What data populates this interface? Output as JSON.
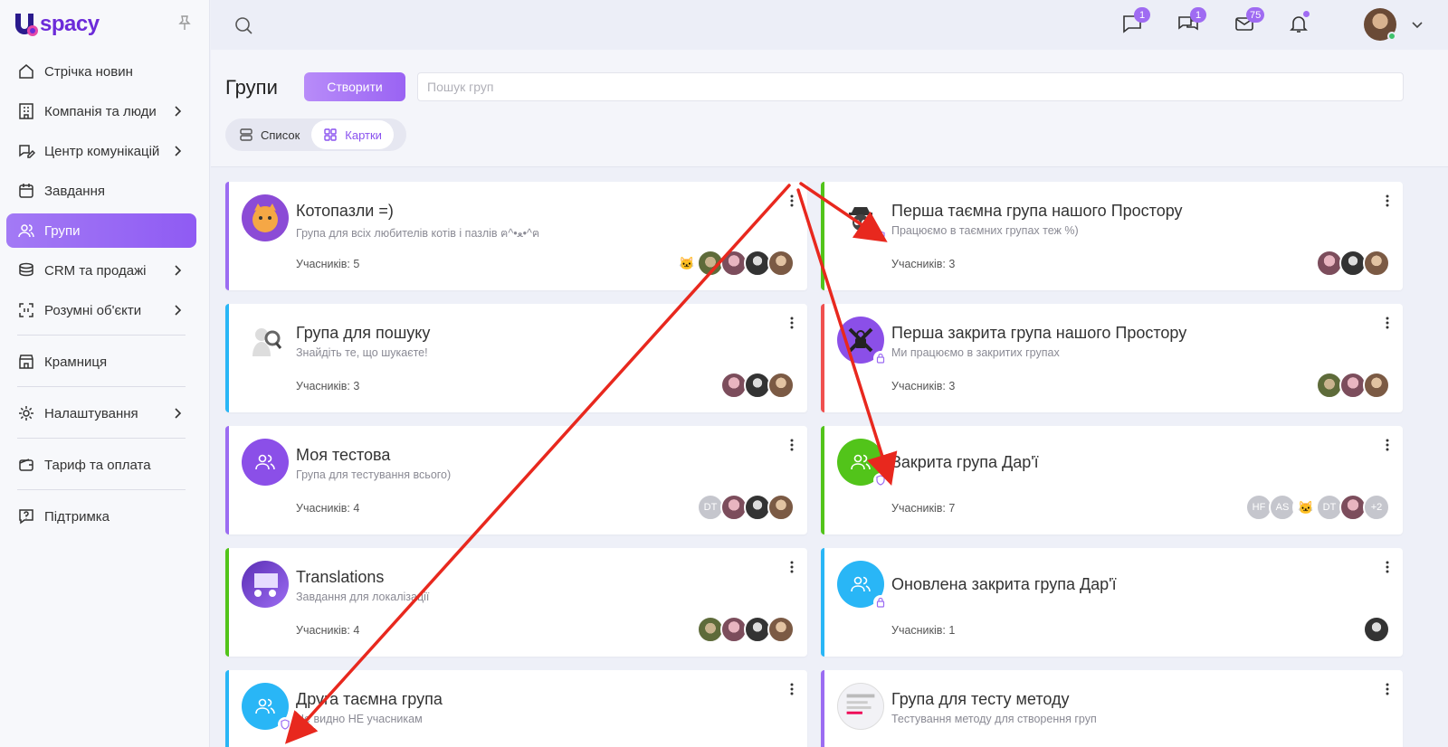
{
  "app": {
    "brand": "spacy",
    "brand_initial": "U"
  },
  "sidebar": {
    "items": [
      {
        "label": "Стрічка новин",
        "icon": "home-icon",
        "chevron": false
      },
      {
        "label": "Компанія та люди",
        "icon": "building-icon",
        "chevron": true
      },
      {
        "label": "Центр комунікацій",
        "icon": "chat-edit-icon",
        "chevron": true
      },
      {
        "label": "Завдання",
        "icon": "calendar-icon",
        "chevron": false
      },
      {
        "label": "Групи",
        "icon": "users-icon",
        "chevron": false,
        "active": true
      },
      {
        "label": "CRM та продажі",
        "icon": "coins-icon",
        "chevron": true
      },
      {
        "label": "Розумні об'єкти",
        "icon": "scan-icon",
        "chevron": true
      },
      {
        "label": "Крамниця",
        "icon": "store-icon",
        "chevron": false
      },
      {
        "label": "Налаштування",
        "icon": "gear-icon",
        "chevron": true
      },
      {
        "label": "Тариф та оплата",
        "icon": "wallet-icon",
        "chevron": false
      },
      {
        "label": "Підтримка",
        "icon": "help-icon",
        "chevron": false
      }
    ]
  },
  "topbar": {
    "chat_badge": "1",
    "messages_badge": "1",
    "mail_badge": "75"
  },
  "header": {
    "title": "Групи",
    "create_label": "Створити",
    "search_placeholder": "Пошук груп",
    "view_list_label": "Список",
    "view_cards_label": "Картки"
  },
  "accent_color": "#9b6cf2",
  "groups": [
    {
      "name": "Котопазли =)",
      "desc": "Група для всіх любителів котів і пазлів ฅ^•ﻌ•^ฅ",
      "count": "Учасників: 5",
      "border": "#9b6cf2"
    },
    {
      "name": "Перша таємна група нашого Простору",
      "desc": "Працюємо в таємних групах теж %)",
      "count": "Учасників: 3",
      "border": "#52c41a"
    },
    {
      "name": "Група для пошуку",
      "desc": "Знайдіть те, що шукаєте!",
      "count": "Учасників: 3",
      "border": "#29b6f6"
    },
    {
      "name": "Перша закрита група нашого Простору",
      "desc": "Ми працюємо в закритих групах",
      "count": "Учасників: 3",
      "border": "#f0504f"
    },
    {
      "name": "Моя тестова",
      "desc": "Група для тестування всього)",
      "count": "Учасників: 4",
      "border": "#9b6cf2",
      "members": [
        "DT"
      ]
    },
    {
      "name": "Закрита група Дар'ї",
      "desc": "",
      "count": "Учасників: 7",
      "border": "#52c41a",
      "members": [
        "HF",
        "AS",
        "DT",
        "+2"
      ]
    },
    {
      "name": "Translations",
      "desc": "Завдання для локалізації",
      "count": "Учасників: 4",
      "border": "#52c41a"
    },
    {
      "name": "Оновлена закрита група Дар'ї",
      "desc": "",
      "count": "Учасників: 1",
      "border": "#29b6f6"
    },
    {
      "name": "Друга таємна група",
      "desc": "Не видно НЕ учасникам",
      "count": "",
      "border": "#29b6f6"
    },
    {
      "name": "Група для тесту методу",
      "desc": "Тестування методу для створення груп",
      "count": "",
      "border": "#9b6cf2"
    }
  ]
}
